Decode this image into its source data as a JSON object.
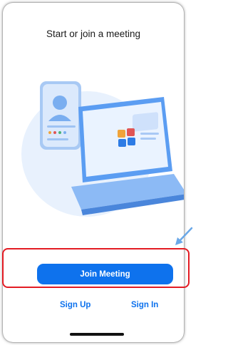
{
  "screen": {
    "title": "Start or join a meeting"
  },
  "actions": {
    "join_label": "Join Meeting",
    "sign_up_label": "Sign Up",
    "sign_in_label": "Sign In"
  },
  "colors": {
    "brand_blue": "#0e72ed",
    "highlight_red": "#e31b23",
    "illustration_bg": "#e8f1fd"
  },
  "icons": [
    "laptop-illustration-icon",
    "contact-card-icon",
    "app-tiles-icon",
    "arrow-pointer-icon"
  ]
}
